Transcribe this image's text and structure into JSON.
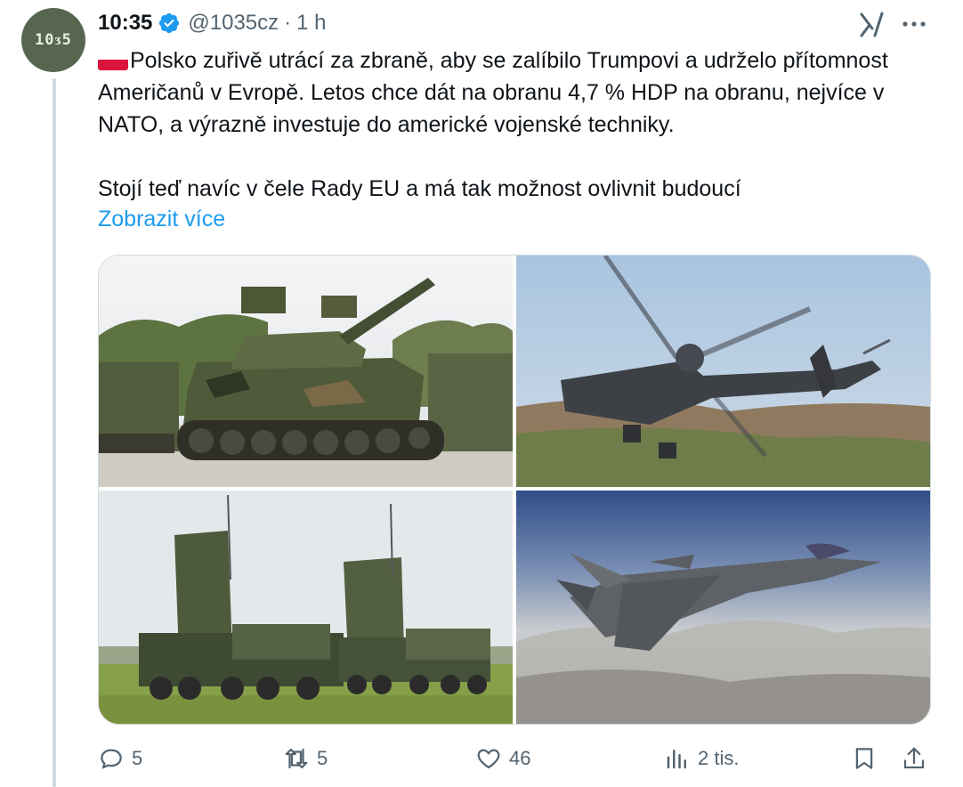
{
  "account": {
    "avatar_text": "10ᴣ5",
    "name": "10:35",
    "handle": "@1035cz",
    "separator": "·",
    "time": "1 h"
  },
  "icons": {
    "avatar": "logo",
    "verified": "verified-badge-icon",
    "grok": "grok-icon",
    "more": "more-icon",
    "reply": "reply-icon",
    "repost": "repost-icon",
    "like": "like-icon",
    "views": "views-icon",
    "bookmark": "bookmark-icon",
    "share": "share-icon"
  },
  "colors": {
    "accent": "#1d9bf0",
    "muted": "#536471",
    "avatar_bg": "#56664f"
  },
  "post": {
    "text": "Polsko zuřivě utrácí za zbraně, aby se zalíbilo Trumpovi a udrželo přítomnost Američanů v Evropě. Letos chce dát na obranu 4,7 % HDP na obranu, nejvíce v NATO, a výrazně investuje do americké vojenské techniky.\n\nStojí teď navíc v čele Rady EU a má tak možnost ovlivnit budoucí",
    "show_more": "Zobrazit více"
  },
  "media": [
    "tank-photo",
    "helicopter-photo",
    "missile-launcher-photo",
    "fighter-jet-photo"
  ],
  "actions": {
    "replies": "5",
    "reposts": "5",
    "likes": "46",
    "views": "2 tis."
  }
}
